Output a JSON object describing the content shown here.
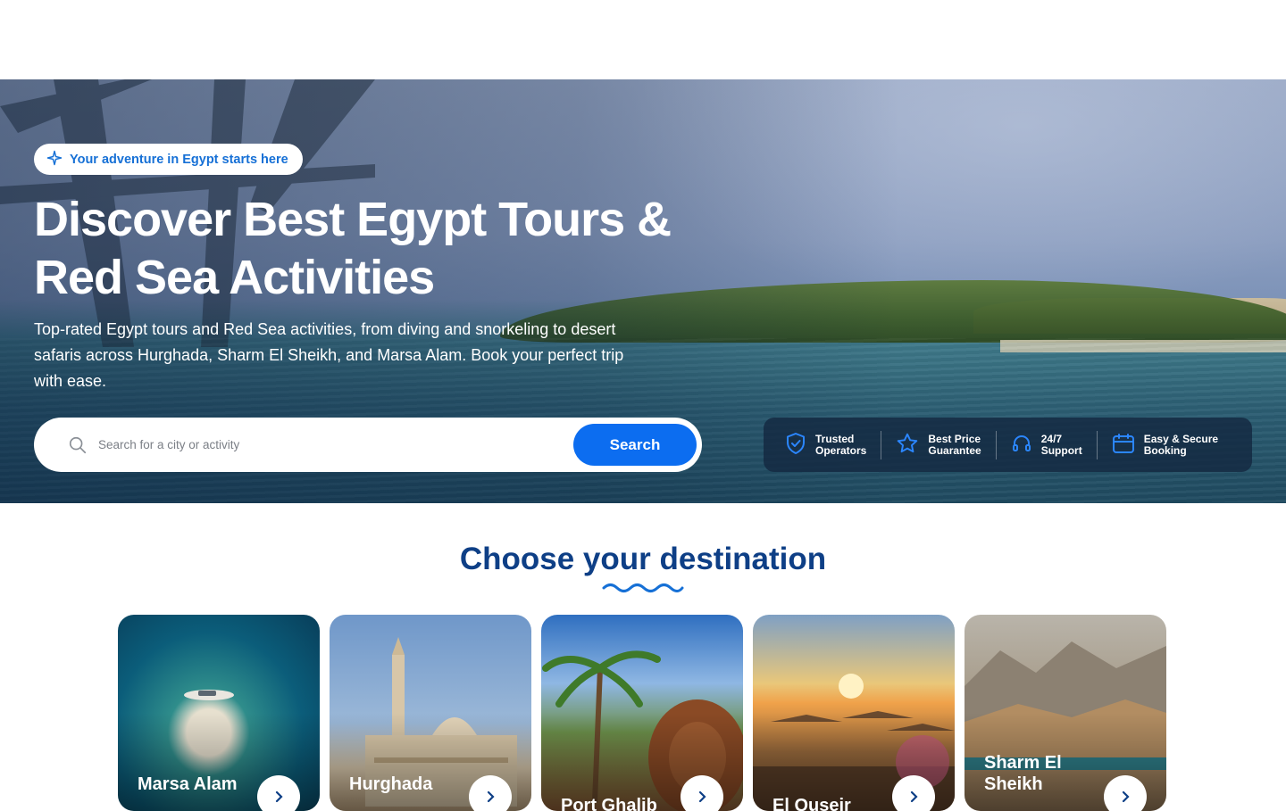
{
  "hero": {
    "badge": "Your adventure in Egypt starts here",
    "title_line1": "Discover Best Egypt Tours &",
    "title_line2": "Red Sea Activities",
    "subtitle": "Top-rated Egypt tours and Red Sea activities, from diving and snorkeling to desert safaris across Hurghada, Sharm El Sheikh, and Marsa Alam. Book your perfect trip with ease."
  },
  "search": {
    "placeholder": "Search for a city or activity",
    "value": "",
    "button_label": "Search"
  },
  "features": [
    {
      "icon": "shield-check-icon",
      "label": "Trusted\nOperators"
    },
    {
      "icon": "star-icon",
      "label": "Best Price\nGuarantee"
    },
    {
      "icon": "headphones-icon",
      "label": "24/7\nSupport"
    },
    {
      "icon": "calendar-icon",
      "label": "Easy & Secure\nBooking"
    }
  ],
  "destinations": {
    "title": "Choose your destination",
    "items": [
      {
        "name": "Marsa Alam"
      },
      {
        "name": "Hurghada"
      },
      {
        "name": "Port Ghalib"
      },
      {
        "name": "El Quseir"
      },
      {
        "name": "Sharm El Sheikh"
      }
    ]
  },
  "colors": {
    "accent": "#0c6df0",
    "badge_text": "#1670d6",
    "heading": "#0e3f86",
    "feature_panel": "#14284180"
  }
}
